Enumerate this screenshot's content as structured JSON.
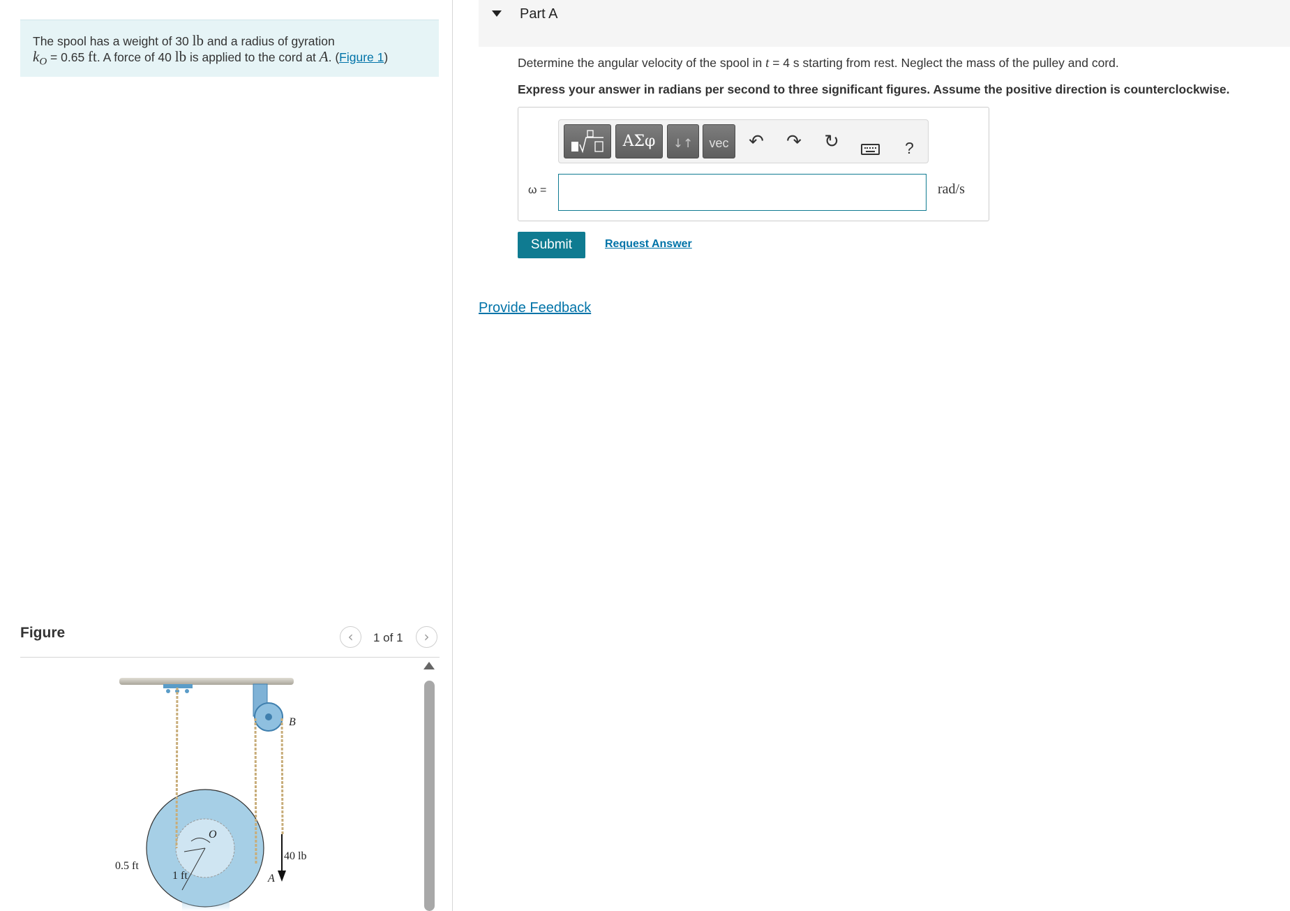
{
  "problem": {
    "text_1": "The spool has a weight of 30 ",
    "unit_lb": "lb",
    "text_2": " and a radius of gyration",
    "k_symbol": "k",
    "k_sub": "O",
    "text_3": " = 0.65 ",
    "unit_ft": "ft",
    "text_4": ". A force of 40 ",
    "text_5": " is applied to the cord at ",
    "point_a": "A",
    "text_6": ". (",
    "figure_link": "Figure 1",
    "text_7": ")"
  },
  "figure": {
    "title": "Figure",
    "page_label": "1 of 1",
    "prev_icon": "chevron-left-icon",
    "next_icon": "chevron-right-icon",
    "labels": {
      "b": "B",
      "o": "O",
      "a": "A",
      "force": "40 lb",
      "inner_radius": "0.5 ft",
      "outer_radius": "1 ft"
    }
  },
  "part": {
    "title": "Part A",
    "question_1": "Determine the angular velocity of the spool in ",
    "question_t": "t",
    "question_2": " = 4 s starting from rest. Neglect the mass of the pulley and cord.",
    "instruction": "Express your answer in radians per second to three significant figures. Assume the positive direction is counterclockwise."
  },
  "toolbar": {
    "templates_icon": "fraction-sqrt-icon",
    "greek_label": "ΑΣφ",
    "arrows_label": "↓↑",
    "vec_label": "vec",
    "undo_icon": "undo-icon",
    "redo_icon": "redo-icon",
    "reset_icon": "reset-icon",
    "keyboard_icon": "keyboard-icon",
    "help_label": "?"
  },
  "answer": {
    "variable_label": "ω =",
    "value": "",
    "units": "rad/s"
  },
  "actions": {
    "submit_label": "Submit",
    "request_answer_label": "Request Answer",
    "feedback_label": "Provide Feedback"
  },
  "colors": {
    "accent": "#0f7b91",
    "link": "#0073a8",
    "problem_bg": "#e6f4f6",
    "spool_fill": "#a6cfe6"
  }
}
